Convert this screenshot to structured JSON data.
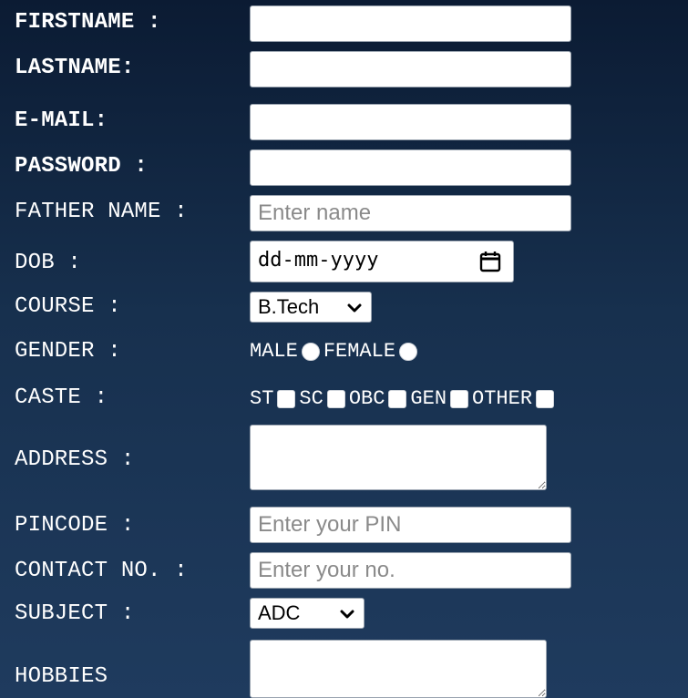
{
  "form": {
    "firstname": {
      "label": "FIRSTNAME :",
      "value": "",
      "placeholder": ""
    },
    "lastname": {
      "label": "LASTNAME:",
      "value": "",
      "placeholder": ""
    },
    "email": {
      "label": "E-MAIL:",
      "value": "",
      "placeholder": ""
    },
    "password": {
      "label": "PASSWORD :",
      "value": "",
      "placeholder": ""
    },
    "father_name": {
      "label": "FATHER NAME :",
      "value": "",
      "placeholder": "Enter name"
    },
    "dob": {
      "label": "DOB :",
      "value": "dd-mm-yyyy",
      "icon": "calendar-icon"
    },
    "course": {
      "label": "COURSE :",
      "selected": "B.Tech",
      "icon": "chevron-down-icon"
    },
    "gender": {
      "label": "GENDER :",
      "options": [
        "MALE",
        "FEMALE"
      ]
    },
    "caste": {
      "label": "CASTE :",
      "options": [
        "ST",
        "SC",
        "OBC",
        "GEN",
        "OTHER"
      ]
    },
    "address": {
      "label": "ADDRESS :",
      "value": ""
    },
    "pincode": {
      "label": "PINCODE :",
      "value": "",
      "placeholder": "Enter your PIN"
    },
    "contact": {
      "label": "CONTACT NO. :",
      "value": "",
      "placeholder": "Enter your no."
    },
    "subject": {
      "label": "SUBJECT :",
      "selected": "ADC",
      "icon": "chevron-down-icon"
    },
    "hobbies": {
      "label": "HOBBIES",
      "value": ""
    }
  },
  "colors": {
    "background_top": "#0b1b33",
    "background_bottom": "#1f3b5e",
    "label_text": "#ffffff",
    "field_background": "#ffffff",
    "placeholder": "#8a8a8a"
  }
}
